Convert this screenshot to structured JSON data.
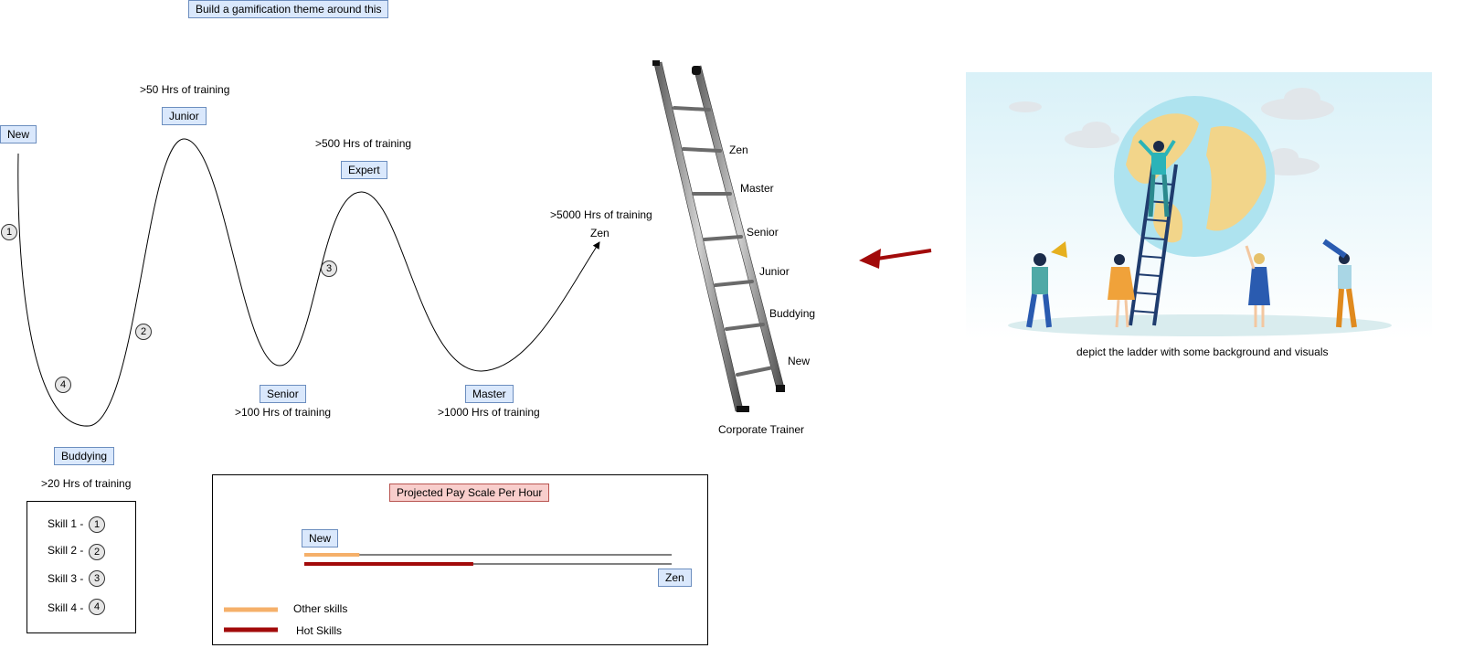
{
  "top_note": "Build a gamification theme around this",
  "levels": {
    "new": "New",
    "buddying": "Buddying",
    "junior": "Junior",
    "senior": "Senior",
    "expert": "Expert",
    "master": "Master",
    "zen": "Zen"
  },
  "hours": {
    "buddying": ">20 Hrs of training",
    "junior": ">50 Hrs of training",
    "senior": ">100 Hrs of training",
    "expert": ">500 Hrs of training",
    "master": ">1000 Hrs of training",
    "zen": ">5000 Hrs of training"
  },
  "markers": [
    "1",
    "2",
    "3",
    "4"
  ],
  "skills_legend": [
    "Skill 1 -",
    "Skill 2 -",
    "Skill 3 -",
    "Skill 4 -"
  ],
  "ladder": {
    "rungs": [
      "Zen",
      "Master",
      "Senior",
      "Junior",
      "Buddying",
      "New"
    ],
    "caption": "Corporate Trainer"
  },
  "illustration_caption": "depict the ladder with some background and visuals",
  "pay_scale": {
    "title": "Projected Pay Scale Per Hour",
    "start_label": "New",
    "end_label": "Zen",
    "other_skills_fill": 0.15,
    "hot_skills_fill": 0.46,
    "legend": [
      "Other skills",
      "Hot Skills"
    ],
    "colors": {
      "other": "#f5b06a",
      "hot": "#a20a0a"
    }
  }
}
